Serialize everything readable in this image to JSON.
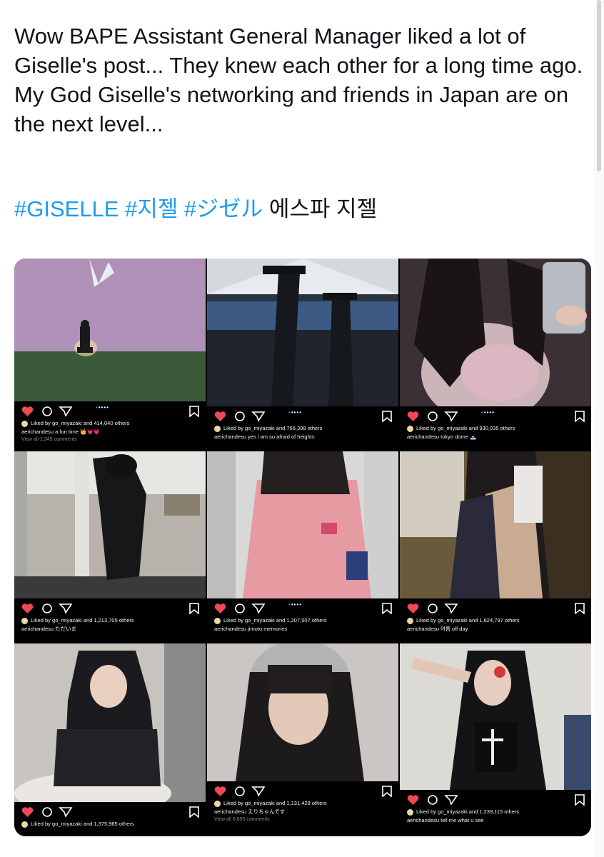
{
  "tweet": {
    "text": "Wow BAPE Assistant General Manager liked a lot of Giselle's post... They knew each other for a long time ago. My God Giselle's networking and friends in Japan are on the next level...",
    "hashtags": [
      "#GISELLE",
      "#지젤",
      "#ジゼル"
    ],
    "trailing_text": "에스파 지젤"
  },
  "colors": {
    "link": "#1d9bf0",
    "heart": "#ed4956",
    "dot_active": "#3897f0"
  },
  "posts": [
    {
      "liked": "Liked by go_miyazaki and 414,040 others",
      "caption": "aerichandesu a fun time 👑💗💗",
      "view_all": "View all 1,345 comments"
    },
    {
      "liked": "Liked by go_miyazaki and 756,398 others",
      "caption": "aerichandesu yes i am so afraid of heights",
      "view_all": ""
    },
    {
      "liked": "Liked by go_miyazaki and 930,035 others",
      "caption": "aerichandesu tokyo dome 🗻",
      "view_all": ""
    },
    {
      "liked": "Liked by go_miyazaki and 1,213,705 others",
      "caption": "aerichandesu ただいま",
      "view_all": ""
    },
    {
      "liked": "Liked by go_miyazaki and 1,207,507 others",
      "caption": "aerichandesu jimoto memories",
      "view_all": ""
    },
    {
      "liked": "Liked by go_miyazaki and 1,624,797 others",
      "caption": "aerichandesu 여름 off day",
      "view_all": ""
    },
    {
      "liked": "Liked by go_miyazaki and 1,375,965 others",
      "caption": "",
      "view_all": ""
    },
    {
      "liked": "Liked by go_miyazaki and 1,131,428 others",
      "caption": "aerichandesu えりちゃんです",
      "view_all": "View all 8,095 comments"
    },
    {
      "liked": "Liked by go_miyazaki and 1,239,115 others",
      "caption": "aerichandesu tell me what u see",
      "view_all": ""
    }
  ],
  "icons": [
    "heart-icon",
    "comment-icon",
    "share-icon",
    "carousel-dots",
    "bookmark-icon"
  ]
}
